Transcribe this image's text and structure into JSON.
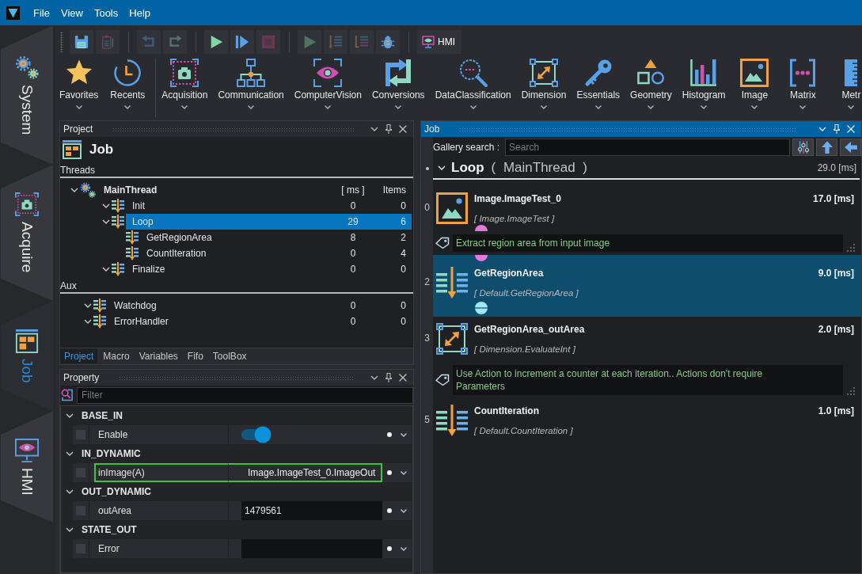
{
  "menu_bar": {
    "items": [
      "File",
      "View",
      "Tools",
      "Help"
    ]
  },
  "side_tabs": [
    {
      "label": "System",
      "selected": false
    },
    {
      "label": "Acquire",
      "selected": false
    },
    {
      "label": "Job",
      "selected": true
    },
    {
      "label": "HMI",
      "selected": false
    }
  ],
  "toolbar": {
    "buttons": [
      {
        "disabled": false
      },
      {
        "disabled": true
      },
      {
        "disabled": true
      },
      {
        "disabled": true
      },
      {
        "disabled": false
      },
      {
        "disabled": false
      },
      {
        "disabled": true
      },
      {
        "disabled": true
      },
      {
        "disabled": true
      },
      {
        "disabled": true
      },
      {
        "disabled": false
      }
    ],
    "hmi_button": "HMI"
  },
  "ribbon": [
    "Favorites",
    "Recents",
    "Acquisition",
    "Communication",
    "ComputerVision",
    "Conversions",
    "DataClassification",
    "Dimension",
    "Essentials",
    "Geometry",
    "Histogram",
    "Image",
    "Matrix",
    "Metr"
  ],
  "project_panel": {
    "title": "Project",
    "heading": "Job",
    "columns": [
      "[ ms ]",
      "Items"
    ],
    "sections": [
      {
        "label": "Threads",
        "items": [
          {
            "kind": "thread",
            "name": "MainThread",
            "expanded": true,
            "selected": false,
            "children": [
              {
                "kind": "task",
                "name": "Init",
                "ms": "0",
                "items": "0",
                "expanded": true,
                "selected": false
              },
              {
                "kind": "task",
                "name": "Loop",
                "ms": "29",
                "items": "6",
                "expanded": true,
                "selected": true,
                "children": [
                  {
                    "kind": "task",
                    "name": "GetRegionArea",
                    "ms": "8",
                    "items": "2",
                    "selected": false
                  },
                  {
                    "kind": "task",
                    "name": "CountIteration",
                    "ms": "0",
                    "items": "4",
                    "selected": false
                  }
                ]
              },
              {
                "kind": "task",
                "name": "Finalize",
                "ms": "0",
                "items": "0",
                "expanded": true,
                "selected": false
              }
            ]
          }
        ]
      },
      {
        "label": "Aux",
        "items": [
          {
            "kind": "task",
            "name": "Watchdog",
            "ms": "0",
            "items": "0",
            "expanded": true,
            "selected": false
          },
          {
            "kind": "task",
            "name": "ErrorHandler",
            "ms": "0",
            "items": "0",
            "expanded": true,
            "selected": false
          }
        ]
      }
    ],
    "tabs": [
      {
        "label": "Project",
        "selected": true
      },
      {
        "label": "Macro",
        "selected": false
      },
      {
        "label": "Variables",
        "selected": false
      },
      {
        "label": "Fifo",
        "selected": false
      },
      {
        "label": "ToolBox",
        "selected": false
      }
    ]
  },
  "property_panel": {
    "title": "Property",
    "filter_placeholder": "Filter",
    "groups": [
      {
        "name": "BASE_IN",
        "expanded": true,
        "rows": [
          {
            "kind": "toggle",
            "label": "Enable",
            "on": true,
            "checked": false,
            "highlighted": false
          }
        ]
      },
      {
        "name": "IN_DYNAMIC",
        "expanded": true,
        "rows": [
          {
            "kind": "link",
            "label": "inImage(A)",
            "value": "Image.ImageTest_0.ImageOut",
            "checked": false,
            "highlighted": true
          }
        ]
      },
      {
        "name": "OUT_DYNAMIC",
        "expanded": true,
        "rows": [
          {
            "kind": "field",
            "label": "outArea",
            "value": "1479561",
            "checked": false,
            "highlighted": false
          }
        ]
      },
      {
        "name": "STATE_OUT",
        "expanded": true,
        "rows": [
          {
            "kind": "field",
            "label": "Error",
            "checked": false,
            "highlighted": false
          }
        ]
      }
    ]
  },
  "job_panel": {
    "title": "Job",
    "search_label": "Gallery search :",
    "search_placeholder": "Search",
    "header": {
      "name": "Loop",
      "context": "( MainThread )",
      "time": "29.0 [ms]",
      "expanded": true
    },
    "steps": [
      {
        "kind": "image",
        "index": "0",
        "name": "Image.ImageTest_0",
        "type": "[ Image.ImageTest ]",
        "time": "17.0 [ms]",
        "selected": false,
        "link_in": false,
        "link_out": true
      },
      {
        "kind": "comment",
        "text": "Extract region area from input image",
        "selected": false
      },
      {
        "kind": "action",
        "index": "2",
        "name": "GetRegionArea",
        "type": "[ Default.GetRegionArea ]",
        "time": "9.0 [ms]",
        "selected": true,
        "link_in": true,
        "link_out": true
      },
      {
        "kind": "dimension",
        "index": "3",
        "name": "GetRegionArea_outArea",
        "type": "[ Dimension.EvaluateInt ]",
        "time": "2.0 [ms]",
        "selected": false,
        "link_in": false,
        "link_out": false
      },
      {
        "kind": "comment",
        "text": "Use Action to increment a counter at each iteration.. Actions don't require Parameters",
        "selected": false
      },
      {
        "kind": "action",
        "index": "5",
        "name": "CountIteration",
        "type": "[ Default.CountIteration ]",
        "time": "1.0 [ms]",
        "selected": false,
        "link_in": false,
        "link_out": false
      }
    ]
  }
}
